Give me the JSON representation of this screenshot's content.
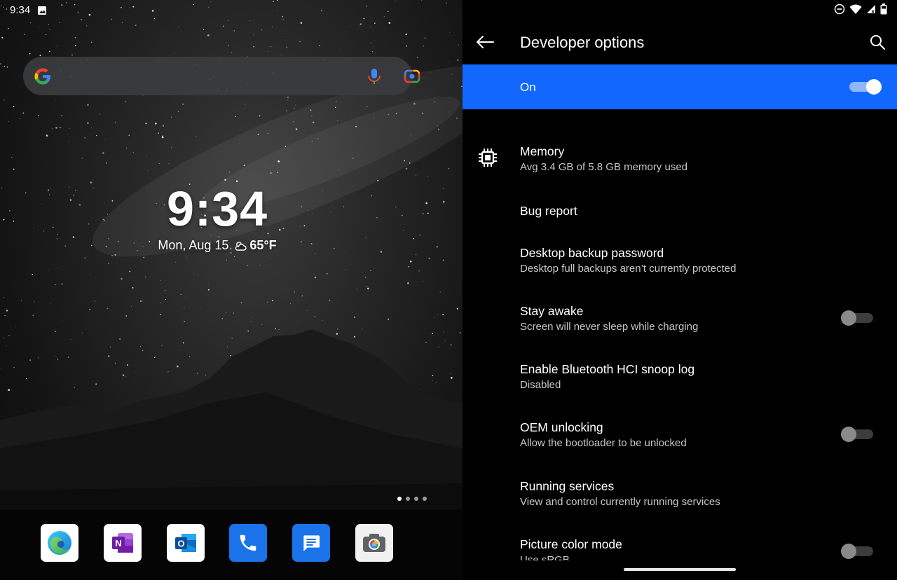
{
  "home": {
    "status_time": "9:34",
    "clock": "9:34",
    "date": "Mon, Aug 15",
    "temperature": "65°F",
    "page_count": 4,
    "active_page": 1,
    "dock": [
      {
        "name": "edge",
        "icon": "edge-icon"
      },
      {
        "name": "onenote",
        "icon": "onenote-icon"
      },
      {
        "name": "outlook",
        "icon": "outlook-icon"
      },
      {
        "name": "phone",
        "icon": "phone-icon"
      },
      {
        "name": "messages",
        "icon": "messages-icon"
      },
      {
        "name": "camera",
        "icon": "camera-icon"
      }
    ]
  },
  "settings": {
    "title": "Developer options",
    "master_switch": {
      "label": "On",
      "on": true
    },
    "accent_color": "#1167ff",
    "prefs": [
      {
        "title": "Memory",
        "summary": "Avg 3.4 GB of 5.8 GB memory used",
        "icon": "memory-chip-icon",
        "toggle": null
      },
      {
        "title": "Bug report",
        "summary": "",
        "toggle": null
      },
      {
        "title": "Desktop backup password",
        "summary": "Desktop full backups aren’t currently protected",
        "toggle": null
      },
      {
        "title": "Stay awake",
        "summary": "Screen will never sleep while charging",
        "toggle": false
      },
      {
        "title": "Enable Bluetooth HCI snoop log",
        "summary": "Disabled",
        "toggle": null
      },
      {
        "title": "OEM unlocking",
        "summary": "Allow the bootloader to be unlocked",
        "toggle": false
      },
      {
        "title": "Running services",
        "summary": "View and control currently running services",
        "toggle": null
      },
      {
        "title": "Picture color mode",
        "summary": "Use sRGB",
        "toggle": false
      }
    ]
  }
}
